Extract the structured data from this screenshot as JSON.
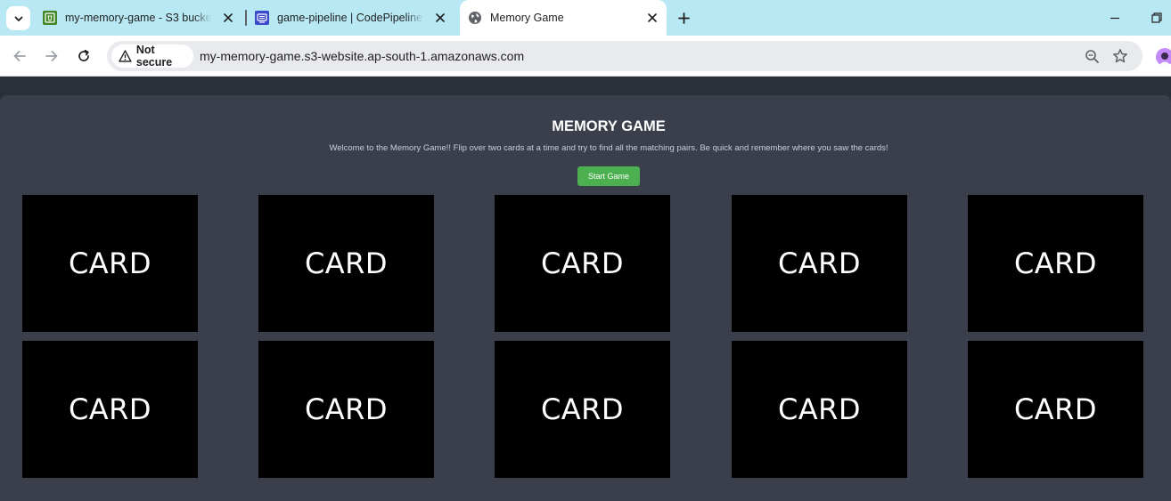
{
  "browser": {
    "tabs": [
      {
        "title": "my-memory-game - S3 bucket",
        "favicon": "s3-bucket-icon",
        "active": false
      },
      {
        "title": "game-pipeline | CodePipeline |",
        "favicon": "codepipeline-icon",
        "active": false
      },
      {
        "title": "Memory Game",
        "favicon": "globe-icon",
        "active": true
      }
    ],
    "security_label": "Not secure",
    "url": "my-memory-game.s3-website.ap-south-1.amazonaws.com",
    "colors": {
      "tabstrip": "#b8e8f4",
      "active_tab": "#ffffff",
      "omnibox": "#e8eaed"
    }
  },
  "game": {
    "title": "MEMORY GAME",
    "description": "Welcome to the Memory Game!! Flip over two cards at a time and try to find all the matching pairs. Be quick and remember where you saw the cards!",
    "start_button": "Start Game",
    "cards": [
      "CARD",
      "CARD",
      "CARD",
      "CARD",
      "CARD",
      "CARD",
      "CARD",
      "CARD",
      "CARD",
      "CARD"
    ],
    "colors": {
      "panel": "#3b3f4b",
      "page": "#2b2f38",
      "card": "#000000",
      "button": "#4caf50"
    }
  }
}
